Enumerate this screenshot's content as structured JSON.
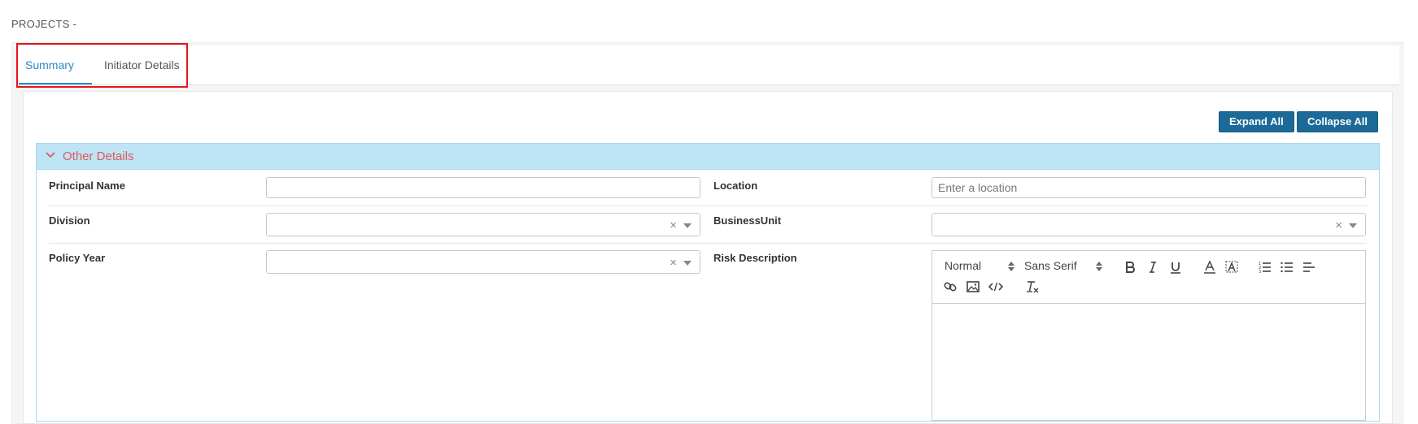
{
  "page": {
    "title": "PROJECTS -"
  },
  "tabs": [
    {
      "label": "Summary",
      "active": true
    },
    {
      "label": "Initiator Details",
      "active": false
    }
  ],
  "actions": {
    "expand_all": "Expand All",
    "collapse_all": "Collapse All"
  },
  "section": {
    "title": "Other Details",
    "icon": "chevron-down-icon",
    "title_color": "#e05a5a",
    "header_bg": "#bde5f6"
  },
  "fields": {
    "principal_name": {
      "label": "Principal Name",
      "value": ""
    },
    "location": {
      "label": "Location",
      "placeholder": "Enter a location"
    },
    "division": {
      "label": "Division",
      "value": ""
    },
    "business_unit": {
      "label": "BusinessUnit",
      "value": ""
    },
    "policy_year": {
      "label": "Policy Year",
      "value": ""
    },
    "risk_description": {
      "label": "Risk Description"
    }
  },
  "editor": {
    "header_picker": "Normal",
    "font_picker": "Sans Serif",
    "buttons": [
      "bold-icon",
      "italic-icon",
      "underline-icon",
      "text-color-icon",
      "background-color-icon",
      "ordered-list-icon",
      "bullet-list-icon",
      "align-icon",
      "link-icon",
      "image-icon",
      "code-icon",
      "clear-format-icon"
    ]
  },
  "colors": {
    "accent": "#2e88c4",
    "button": "#1b6a98",
    "highlight": "#e8141a"
  }
}
